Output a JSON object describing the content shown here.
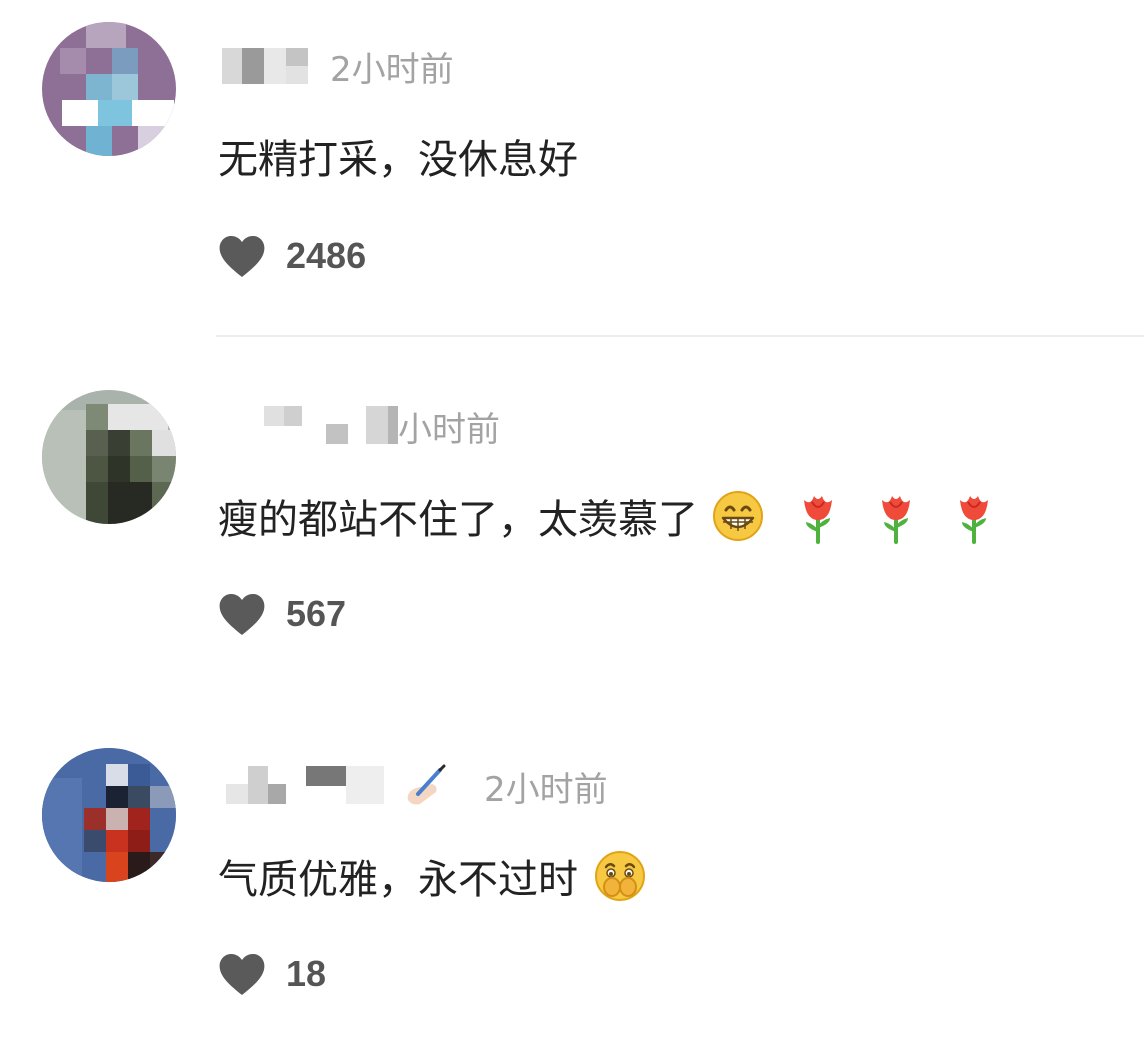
{
  "comments": [
    {
      "time": "2小时前",
      "text": "无精打采，没休息好",
      "likes": "2486",
      "emojis": []
    },
    {
      "time": "小时前",
      "text": "瘦的都站不住了，太羡慕了",
      "likes": "567",
      "emojis": [
        "grin-emoji",
        "rose-emoji",
        "rose-emoji",
        "rose-emoji"
      ]
    },
    {
      "time": "2小时前",
      "text": "气质优雅，永不过时",
      "likes": "18",
      "emojis": [
        "covered-mouth-emoji"
      ]
    }
  ],
  "colors": {
    "text": "#222222",
    "time": "#a3a3a3",
    "like_icon": "#5a5a5a",
    "like_count": "#555555",
    "divider": "#ededed"
  }
}
